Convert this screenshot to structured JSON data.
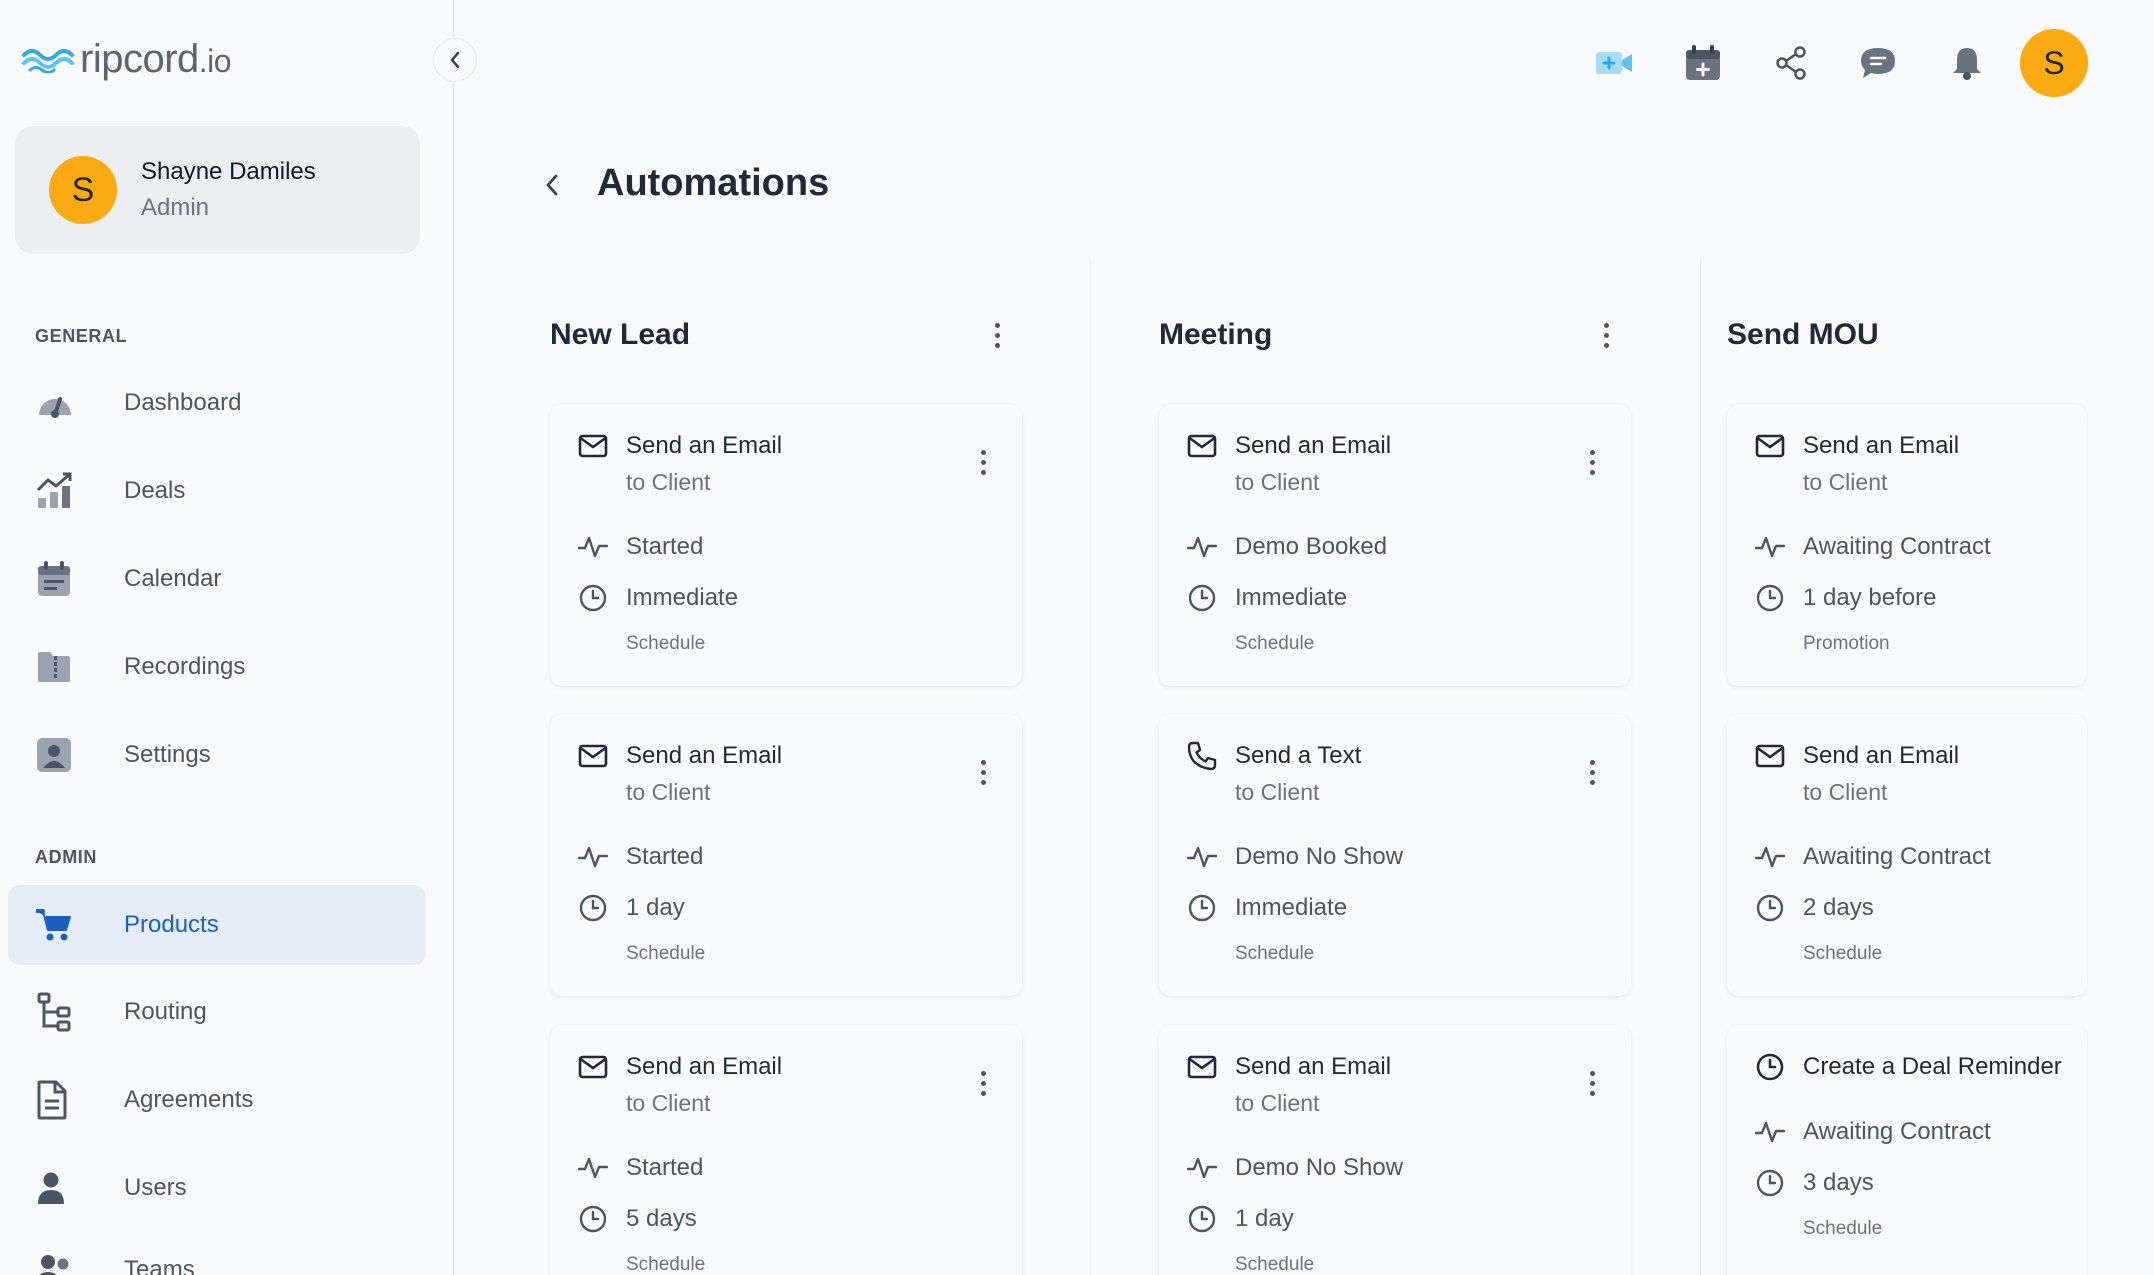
{
  "brand": {
    "name": "ripcord",
    "tld": ".io"
  },
  "user": {
    "initial": "S",
    "name": "Shayne Damiles",
    "role": "Admin"
  },
  "sidebar": {
    "general_label": "GENERAL",
    "general_items": [
      {
        "label": "Dashboard",
        "icon": "dashboard-gauge-icon"
      },
      {
        "label": "Deals",
        "icon": "deals-chart-icon"
      },
      {
        "label": "Calendar",
        "icon": "calendar-icon"
      },
      {
        "label": "Recordings",
        "icon": "recordings-folder-icon"
      },
      {
        "label": "Settings",
        "icon": "settings-user-icon"
      }
    ],
    "admin_label": "ADMIN",
    "admin_items": [
      {
        "label": "Products",
        "icon": "cart-icon",
        "active": true
      },
      {
        "label": "Routing",
        "icon": "routing-tree-icon"
      },
      {
        "label": "Agreements",
        "icon": "document-icon"
      },
      {
        "label": "Users",
        "icon": "user-icon"
      },
      {
        "label": "Teams",
        "icon": "teams-icon"
      }
    ]
  },
  "topbar": {
    "icons": [
      "video-call-icon",
      "calendar-add-icon",
      "share-icon",
      "chat-icon",
      "bell-icon"
    ],
    "avatar_initial": "S"
  },
  "page": {
    "title": "Automations"
  },
  "columns": [
    {
      "title": "New Lead",
      "cards": [
        {
          "action": "Send an Email",
          "action_icon": "mail-icon",
          "target": "to Client",
          "stage": "Started",
          "timing": "Immediate",
          "type": "Schedule"
        },
        {
          "action": "Send an Email",
          "action_icon": "mail-icon",
          "target": "to Client",
          "stage": "Started",
          "timing": "1 day",
          "type": "Schedule"
        },
        {
          "action": "Send an Email",
          "action_icon": "mail-icon",
          "target": "to Client",
          "stage": "Started",
          "timing": "5 days",
          "type": "Schedule"
        }
      ]
    },
    {
      "title": "Meeting",
      "cards": [
        {
          "action": "Send an Email",
          "action_icon": "mail-icon",
          "target": "to Client",
          "stage": "Demo Booked",
          "timing": "Immediate",
          "type": "Schedule"
        },
        {
          "action": "Send a Text",
          "action_icon": "phone-icon",
          "target": "to Client",
          "stage": "Demo No Show",
          "timing": "Immediate",
          "type": "Schedule"
        },
        {
          "action": "Send an Email",
          "action_icon": "mail-icon",
          "target": "to Client",
          "stage": "Demo No Show",
          "timing": "1 day",
          "type": "Schedule"
        }
      ]
    },
    {
      "title": "Send MOU",
      "cards": [
        {
          "action": "Send an Email",
          "action_icon": "mail-icon",
          "target": "to Client",
          "stage": "Awaiting Contract",
          "timing": "1 day before",
          "type": "Promotion"
        },
        {
          "action": "Send an Email",
          "action_icon": "mail-icon",
          "target": "to Client",
          "stage": "Awaiting Contract",
          "timing": "2 days",
          "type": "Schedule"
        },
        {
          "action": "Create a Deal Reminder",
          "action_icon": "clock-icon",
          "target": "",
          "stage": "Awaiting Contract",
          "timing": "3 days",
          "type": "Schedule"
        }
      ]
    }
  ]
}
